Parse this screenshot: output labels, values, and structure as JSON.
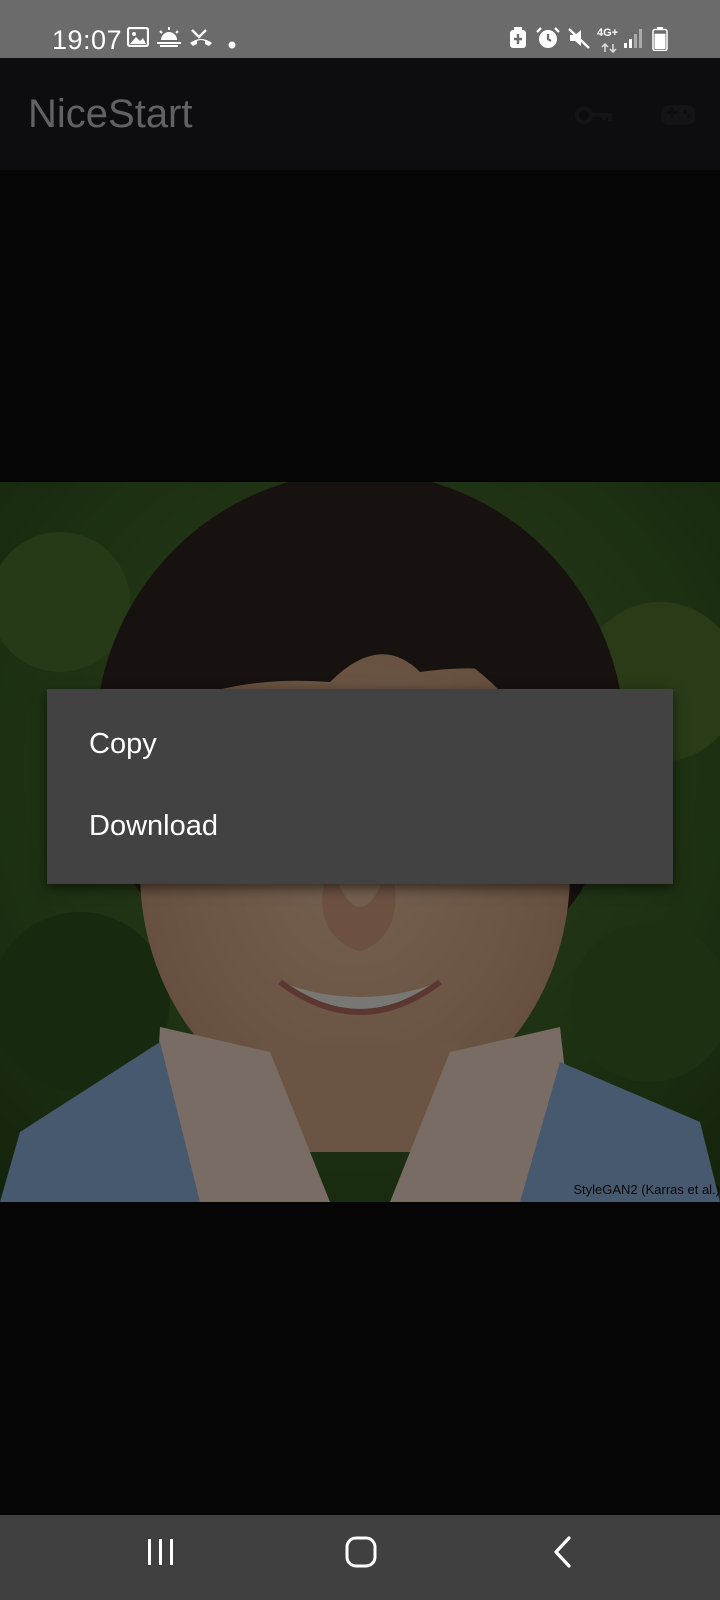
{
  "status_bar": {
    "time": "19:07",
    "network_label": "4G+",
    "icons": [
      "gallery-icon",
      "sunrise-weather-icon",
      "missed-call-icon",
      "notification-dot-icon",
      "battery-saver-icon",
      "alarm-icon",
      "mute-icon",
      "signal-icon",
      "battery-icon"
    ],
    "battery_level": 0.85
  },
  "app_bar": {
    "title": "NiceStart",
    "actions": [
      "key-icon",
      "gamepad-icon"
    ]
  },
  "photo": {
    "watermark": "StyleGAN2 (Karras et al.)"
  },
  "context_menu": {
    "items": [
      {
        "label": "Copy"
      },
      {
        "label": "Download"
      }
    ]
  },
  "nav_bar": {
    "buttons": [
      "recent-apps-icon",
      "home-icon",
      "back-icon"
    ]
  },
  "colors": {
    "status_bar": "#6b6b6b",
    "app_bar": "#0d0d0f",
    "background": "#050505",
    "menu": "#424242",
    "nav_bar": "#404040"
  }
}
